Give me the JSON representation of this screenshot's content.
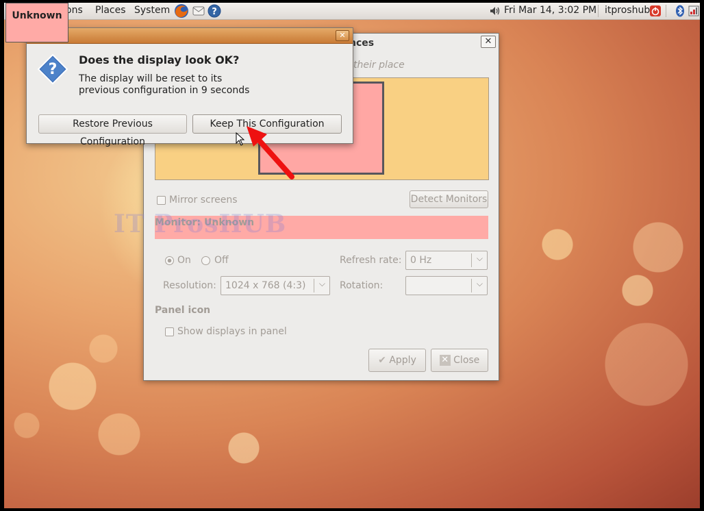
{
  "top_panel": {
    "menu_applications_visible": "ons",
    "menu_places": "Places",
    "menu_system": "System",
    "clock": "Fri Mar 14,  3:02 PM",
    "user": "itproshub"
  },
  "overlay_badge": {
    "label": "Unknown"
  },
  "prefs_window": {
    "title_fragment": "nces",
    "hint_fragment": "their place",
    "mirror_label": "Mirror screens",
    "detect_label": "Detect Monitors",
    "monitor_label": "Monitor: Unknown",
    "on_label": "On",
    "off_label": "Off",
    "refresh_label": "Refresh rate:",
    "refresh_value": "0 Hz",
    "resolution_label": "Resolution:",
    "resolution_value": "1024 x 768 (4:3)",
    "rotation_label": "Rotation:",
    "rotation_value": "",
    "panel_icon_heading": "Panel icon",
    "show_displays_label": "Show displays in panel",
    "apply_label": "Apply",
    "close_label": "Close"
  },
  "watermark": "IT ProsHUB",
  "dialog": {
    "heading": "Does the display look OK?",
    "message_line1": "The display will be reset to its",
    "message_line2": "previous configuration in 9 seconds",
    "restore_label": "Restore Previous Configuration",
    "keep_label": "Keep This Configuration"
  },
  "colors": {
    "annotation_arrow": "#ee1111",
    "monitor_highlight": "#ffaaa6",
    "arrangement_bg": "#f9d083",
    "dialog_titlebar": "#d68b45"
  },
  "icons": [
    "firefox-icon",
    "mail-icon",
    "help-icon",
    "volume-icon",
    "power-icon",
    "bluetooth-icon",
    "network-icon",
    "question-icon",
    "check-icon",
    "close-icon"
  ]
}
